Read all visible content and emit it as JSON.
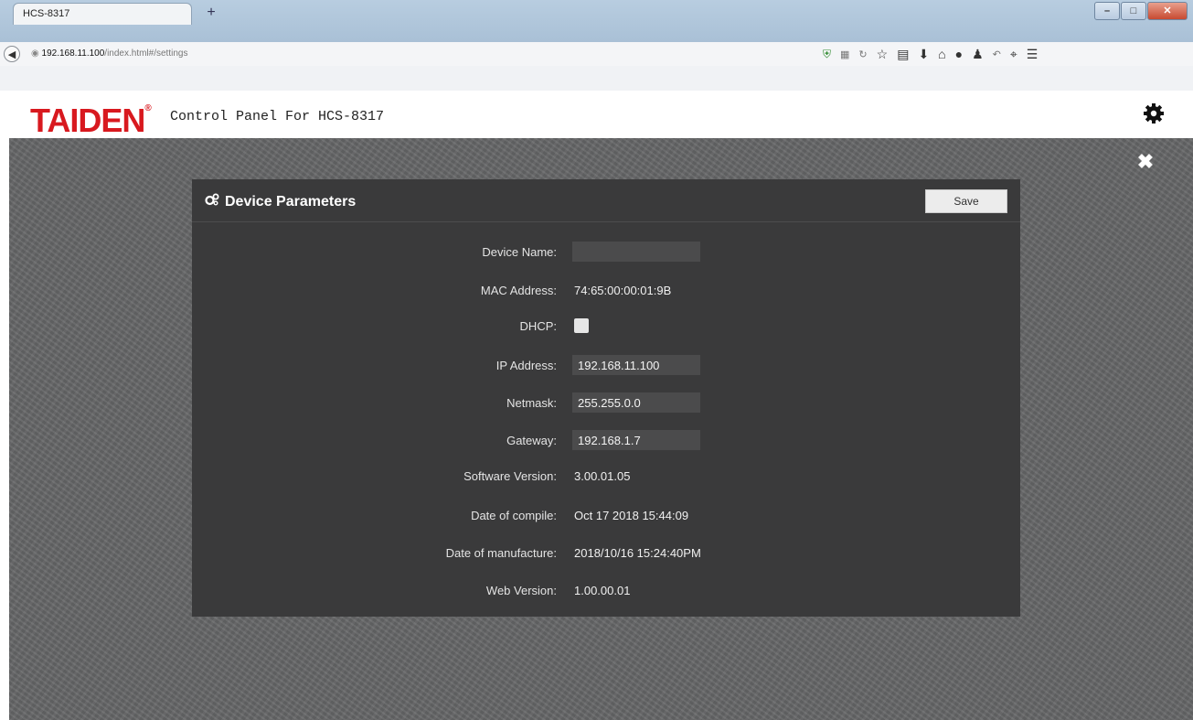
{
  "browser": {
    "tab_title": "HCS-8317",
    "new_tab_symbol": "+",
    "url_host": "192.168.11.100",
    "url_path": "/index.html#/settings"
  },
  "header": {
    "logo_text": "TAIDEN",
    "logo_mark": "®",
    "subtitle": "Control Panel For HCS-8317"
  },
  "modal": {
    "title": "Device Parameters",
    "save_label": "Save",
    "fields": {
      "device_name": {
        "label": "Device Name:",
        "value": ""
      },
      "mac": {
        "label": "MAC Address:",
        "value": "74:65:00:00:01:9B"
      },
      "dhcp": {
        "label": "DHCP:",
        "checked": false
      },
      "ip": {
        "label": "IP Address:",
        "value": "192.168.11.100"
      },
      "netmask": {
        "label": "Netmask:",
        "value": "255.255.0.0"
      },
      "gateway": {
        "label": "Gateway:",
        "value": "192.168.1.7"
      },
      "software_version": {
        "label": "Software Version:",
        "value": "3.00.01.05"
      },
      "date_compile": {
        "label": "Date of compile:",
        "value": "Oct 17 2018 15:44:09"
      },
      "date_manufacture": {
        "label": "Date of manufacture:",
        "value": "2018/10/16 15:24:40PM"
      },
      "web_version": {
        "label": "Web Version:",
        "value": "1.00.00.01"
      }
    }
  },
  "colors": {
    "brand_red": "#d8191f",
    "modal_bg": "#3a3a3b",
    "page_bg": "#666768"
  },
  "icons": [
    "back-arrow-icon",
    "globe-icon",
    "shield-icon",
    "qr-icon",
    "reload-icon",
    "star-icon",
    "reading-list-icon",
    "download-icon",
    "home-icon",
    "chat-icon",
    "person-icon",
    "undo-icon",
    "crop-icon",
    "menu-icon",
    "gear-icon",
    "close-icon",
    "settings-cogs-icon"
  ]
}
